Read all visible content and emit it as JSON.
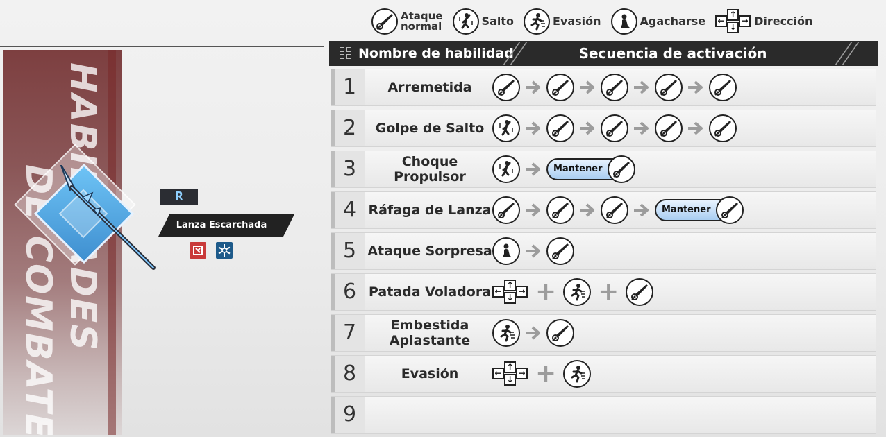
{
  "legend": {
    "attack_line1": "Ataque",
    "attack_line2": "normal",
    "jump": "Salto",
    "evade": "Evasión",
    "crouch": "Agacharse",
    "direction": "Dirección"
  },
  "panel": {
    "banner_line1": "HABILIDADES",
    "banner_line2": "DE COMBATE",
    "rank": "R",
    "weapon_name": "Lanza Escarchada"
  },
  "table": {
    "col_name": "Nombre de habilidad",
    "col_seq": "Secuencia de activación",
    "hold_label": "Mantener",
    "rows": [
      {
        "num": "1",
        "name": "Arremetida",
        "seq": [
          "attack",
          "arrow",
          "attack",
          "arrow",
          "attack",
          "arrow",
          "attack",
          "arrow",
          "attack"
        ]
      },
      {
        "num": "2",
        "name": "Golpe de Salto",
        "seq": [
          "jump",
          "arrow",
          "attack",
          "arrow",
          "attack",
          "arrow",
          "attack",
          "arrow",
          "attack"
        ]
      },
      {
        "num": "3",
        "name": "Choque\nPropulsor",
        "seq": [
          "jump",
          "arrow",
          "hold"
        ]
      },
      {
        "num": "4",
        "name": "Ráfaga de Lanza",
        "seq": [
          "attack",
          "arrow",
          "attack",
          "arrow",
          "attack",
          "arrow",
          "hold"
        ]
      },
      {
        "num": "5",
        "name": "Ataque Sorpresa",
        "seq": [
          "crouch",
          "arrow",
          "attack"
        ]
      },
      {
        "num": "6",
        "name": "Patada Voladora",
        "seq": [
          "dpad",
          "plus",
          "evade",
          "plus",
          "attack"
        ]
      },
      {
        "num": "7",
        "name": "Embestida\nAplastante",
        "seq": [
          "evade",
          "arrow",
          "attack"
        ]
      },
      {
        "num": "8",
        "name": "Evasión",
        "seq": [
          "dpad",
          "plus",
          "evade"
        ]
      },
      {
        "num": "9",
        "name": "",
        "seq": []
      }
    ]
  },
  "icons": {
    "attack": "sword-icon",
    "jump": "jump-icon",
    "evade": "dodge-icon",
    "crouch": "crouch-icon",
    "direction": "dpad-icon"
  },
  "colors": {
    "banner": "#8a5657",
    "header": "#2a2a2a",
    "weapon_bg": "#4fa3e0",
    "hold_pill": "#a9cdf1"
  }
}
